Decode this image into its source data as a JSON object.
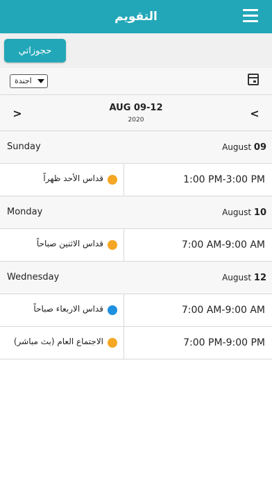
{
  "header": {
    "title": "التقويم",
    "menu_icon": "hamburger-menu-icon",
    "color": "#22a7b8"
  },
  "subbar": {
    "bookings_label": "حجوزاتي"
  },
  "toolbar": {
    "view_select": "اجندة",
    "calendar_icon": "calendar-icon"
  },
  "range": {
    "label": "AUG 09-12",
    "year": "2020"
  },
  "days": [
    {
      "name": "Sunday",
      "month": "August",
      "day": "09",
      "events": [
        {
          "time": "1:00 PM-3:00 PM",
          "title": "قداس الأحد ظهراً",
          "color": "#f5a623"
        }
      ]
    },
    {
      "name": "Monday",
      "month": "August",
      "day": "10",
      "events": [
        {
          "time": "7:00 AM-9:00 AM",
          "title": "قداس الاثنين صباحاً",
          "color": "#f5a623"
        }
      ]
    },
    {
      "name": "Wednesday",
      "month": "August",
      "day": "12",
      "events": [
        {
          "time": "7:00 AM-9:00 AM",
          "title": "قداس الاربعاء صباحاً",
          "color": "#1e90e0"
        },
        {
          "time": "7:00 PM-9:00 PM",
          "title": "الاجتماع العام (بث مباشر)",
          "color": "#f5a623"
        }
      ]
    }
  ]
}
